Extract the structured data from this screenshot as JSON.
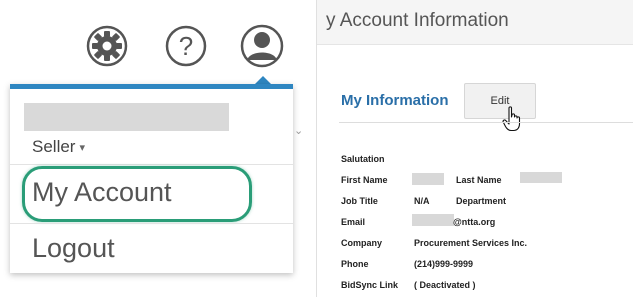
{
  "header": {
    "icons": [
      {
        "name": "gear-icon"
      },
      {
        "name": "help-icon",
        "glyph": "?"
      },
      {
        "name": "user-icon"
      }
    ]
  },
  "dropdown": {
    "seller_label": "Seller",
    "seller_caret": "▾",
    "my_account_label": "My Account",
    "logout_label": "Logout",
    "accent_color": "#2e86c1",
    "highlight_color": "#2a9d78",
    "scroll_glyph": "⌄"
  },
  "account": {
    "page_title": "y Account Information",
    "section_title": "My Information",
    "edit_label": "Edit",
    "fields": {
      "salutation_label": "Salutation",
      "first_name_label": "First Name",
      "last_name_label": "Last Name",
      "job_title_label": "Job Title",
      "job_title_value": "N/A",
      "department_label": "Department",
      "email_label": "Email",
      "email_value": "@ntta.org",
      "company_label": "Company",
      "company_value": "Procurement Services Inc.",
      "phone_label": "Phone",
      "phone_value": "(214)999-9999",
      "bidsync_label": "BidSync Link",
      "bidsync_value": "( Deactivated )"
    }
  }
}
